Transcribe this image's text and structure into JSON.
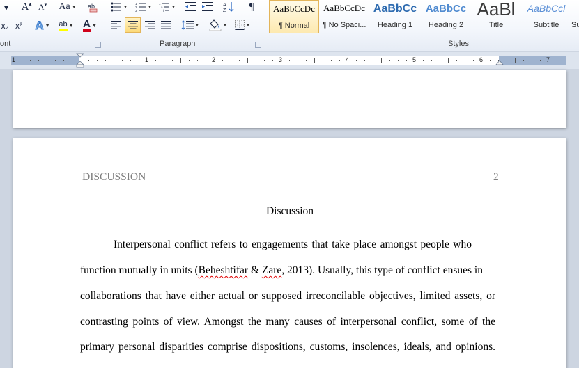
{
  "ribbon": {
    "groups": {
      "font": "ont",
      "paragraph": "Paragraph",
      "styles": "Styles"
    },
    "font": {
      "grow_icon": "grow-font-icon",
      "shrink_icon": "shrink-font-icon",
      "change_case_label": "Aa",
      "subscript_label": "x₂",
      "superscript_label": "x²",
      "font_color_label": "A",
      "font_color": "#d0021b",
      "highlight_label": "ab",
      "highlight_color": "#ffff00"
    },
    "paragraph": {
      "active_alignment": "center",
      "pilcrow": "¶"
    },
    "styles": [
      {
        "sample": "AaBbCcDc",
        "name": "¶ Normal",
        "selected": true
      },
      {
        "sample": "AaBbCcDc",
        "name": "¶ No Spaci...",
        "selected": false
      },
      {
        "sample": "AaBbCc",
        "name": "Heading 1",
        "selected": false
      },
      {
        "sample": "AaBbCc",
        "name": "Heading 2",
        "selected": false
      },
      {
        "sample": "AaBl",
        "name": "Title",
        "selected": false
      },
      {
        "sample": "AaBbCcl",
        "name": "Subtitle",
        "selected": false
      },
      {
        "sample": "",
        "name": "Su",
        "selected": false
      }
    ]
  },
  "ruler": {
    "numbers": [
      "1",
      "1",
      "2",
      "3",
      "4",
      "5",
      "6",
      "7"
    ]
  },
  "document": {
    "header_left": "DISCUSSION",
    "page_number": "2",
    "heading": "Discussion",
    "lines": [
      "Interpersonal conflict refers to engagements that take place amongst people who",
      "function mutually in units (",
      "collaborations that have either actual or supposed irreconcilable  objectives, limited assets, or",
      "contrasting points of view. Amongst the many causes of interpersonal conflict, some of the",
      "primary personal disparities comprise dispositions, customs, insolences, ideals, and opinions."
    ],
    "citation_author": "Beheshtifar",
    "citation_amp": " & ",
    "citation_author2": "Zare",
    "citation_rest": ", 2013). Usually, this type of conflict ensues in"
  }
}
